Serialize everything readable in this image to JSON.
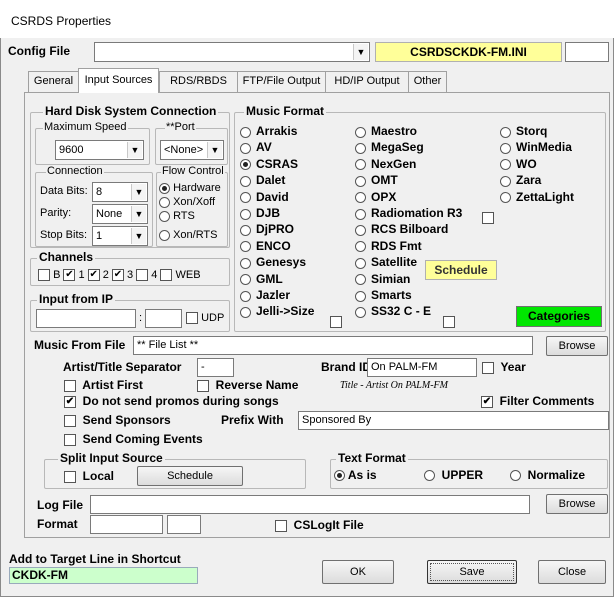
{
  "window": {
    "title": "CSRDS Properties"
  },
  "config": {
    "label": "Config File",
    "value": "",
    "file_name": "CSRDSCKDK-FM.INI",
    "extra": ""
  },
  "tabs": [
    "General",
    "Input Sources",
    "RDS/RBDS",
    "FTP/File Output",
    "HD/IP Output",
    "Other"
  ],
  "hdsc": {
    "title": "Hard Disk System Connection",
    "speed_label": "Maximum Speed",
    "speed_value": "9600",
    "port_label": "**Port",
    "port_value": "<None>",
    "connection_label": "Connection",
    "data_bits_label": "Data Bits:",
    "data_bits_value": "8",
    "parity_label": "Parity:",
    "parity_value": "None",
    "stop_bits_label": "Stop Bits:",
    "stop_bits_value": "1",
    "flow_label": "Flow Control",
    "flow": [
      {
        "label": "Hardware",
        "on": true
      },
      {
        "label": "Xon/Xoff",
        "on": false
      },
      {
        "label": "RTS",
        "on": false
      },
      {
        "label": "Xon/RTS",
        "on": false
      }
    ]
  },
  "channels": {
    "title": "Channels",
    "items": [
      {
        "label": "B",
        "checked": false
      },
      {
        "label": "1",
        "checked": true
      },
      {
        "label": "2",
        "checked": true
      },
      {
        "label": "3",
        "checked": true
      },
      {
        "label": "4",
        "checked": false
      }
    ],
    "web_label": "WEB",
    "web_checked": false
  },
  "input_ip": {
    "title": "Input from IP",
    "ip": "",
    "sep": ":",
    "port": "",
    "udp_label": "UDP",
    "udp_checked": false
  },
  "music_format": {
    "title": "Music Format",
    "col1": [
      {
        "label": "Arrakis",
        "on": false
      },
      {
        "label": "AV",
        "on": false
      },
      {
        "label": "CSRAS",
        "on": true
      },
      {
        "label": "Dalet",
        "on": false
      },
      {
        "label": "David",
        "on": false
      },
      {
        "label": "DJB",
        "on": false
      },
      {
        "label": "DjPRO",
        "on": false
      },
      {
        "label": "ENCO",
        "on": false
      },
      {
        "label": "Genesys",
        "on": false
      },
      {
        "label": "GML",
        "on": false
      },
      {
        "label": "Jazler",
        "on": false
      },
      {
        "label": "Jelli->Size",
        "on": false
      }
    ],
    "col2": [
      {
        "label": "Maestro",
        "on": false
      },
      {
        "label": "MegaSeg",
        "on": false
      },
      {
        "label": "NexGen",
        "on": false
      },
      {
        "label": "OMT",
        "on": false
      },
      {
        "label": "OPX",
        "on": false
      },
      {
        "label": "Radiomation R3",
        "on": false
      },
      {
        "label": "RCS Bilboard",
        "on": false
      },
      {
        "label": "RDS Fmt",
        "on": false
      },
      {
        "label": "Satellite",
        "on": false
      },
      {
        "label": "Simian",
        "on": false
      },
      {
        "label": "Smarts",
        "on": false
      },
      {
        "label": "SS32 C - E",
        "on": false
      }
    ],
    "col3": [
      {
        "label": "Storq",
        "on": false
      },
      {
        "label": "WinMedia",
        "on": false
      },
      {
        "label": "WO",
        "on": false
      },
      {
        "label": "Zara",
        "on": false
      },
      {
        "label": "ZettaLight",
        "on": false
      }
    ],
    "schedule_label": "Schedule",
    "categories_label": "Categories"
  },
  "music_file": {
    "label": "Music From File",
    "value": "** File List **",
    "browse": "Browse"
  },
  "artist_sep": {
    "label": "Artist/Title Separator",
    "value": "-"
  },
  "brand": {
    "label": "Brand ID",
    "value": "On PALM-FM",
    "year_label": "Year"
  },
  "artist_first": "Artist First",
  "reverse_name": "Reverse Name",
  "preview": "Title - Artist On PALM-FM",
  "no_promos": "Do not send promos during songs",
  "filter_comments": "Filter Comments",
  "send_sponsors": "Send Sponsors",
  "prefix_label": "Prefix With",
  "prefix_value": "Sponsored By",
  "send_coming": "Send Coming Events",
  "split": {
    "title": "Split Input Source",
    "local": "Local",
    "schedule": "Schedule"
  },
  "text_format": {
    "title": "Text Format",
    "options": [
      "As is",
      "UPPER",
      "Normalize"
    ]
  },
  "log_file": {
    "label": "Log File",
    "value": "",
    "browse": "Browse"
  },
  "format": {
    "label": "Format",
    "value1": "",
    "value2": "",
    "cslogit": "CSLogIt File"
  },
  "target": {
    "label": "Add to Target Line in Shortcut",
    "value": "CKDK-FM"
  },
  "buttons": {
    "ok": "OK",
    "save": "Save",
    "close": "Close"
  },
  "colors": {
    "file_name_bg": "#ffff99",
    "categories_bg": "#00e600",
    "schedule_bg": "#ffff99",
    "target_bg": "#ccffcc"
  }
}
